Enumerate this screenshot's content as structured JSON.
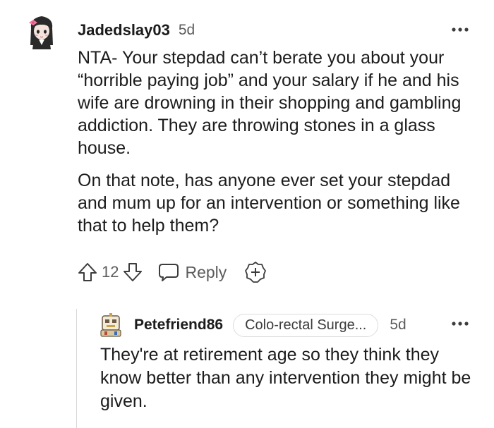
{
  "comment": {
    "username": "Jadedslay03",
    "time": "5d",
    "paragraphs": [
      "NTA- Your stepdad can’t berate you about your “horrible paying job” and your salary if he and his wife are drowning in their shopping and gambling addiction. They are throwing stones in a glass house.",
      "On that note, has anyone ever set your stepdad and mum up for an intervention or something like that to help them?"
    ],
    "vote_count": "12",
    "reply_label": "Reply",
    "icons": {
      "avatar": "anime-girl-avatar",
      "upvote": "arrow-up-icon",
      "downvote": "arrow-down-icon",
      "reply": "speech-bubble-icon",
      "award": "award-plus-icon",
      "more": "more-dots-icon"
    }
  },
  "reply": {
    "username": "Petefriend86",
    "flair": "Colo-rectal Surge...",
    "time": "5d",
    "body": "They're at retirement age so they think they know better than any intervention they might be given.",
    "icons": {
      "avatar": "robot-avatar",
      "more": "more-dots-icon"
    }
  },
  "colors": {
    "text": "#1c1c1c",
    "meta": "#5c5c5c",
    "thread_line": "#d8d8d8",
    "flair_border": "#dcdcdc"
  }
}
